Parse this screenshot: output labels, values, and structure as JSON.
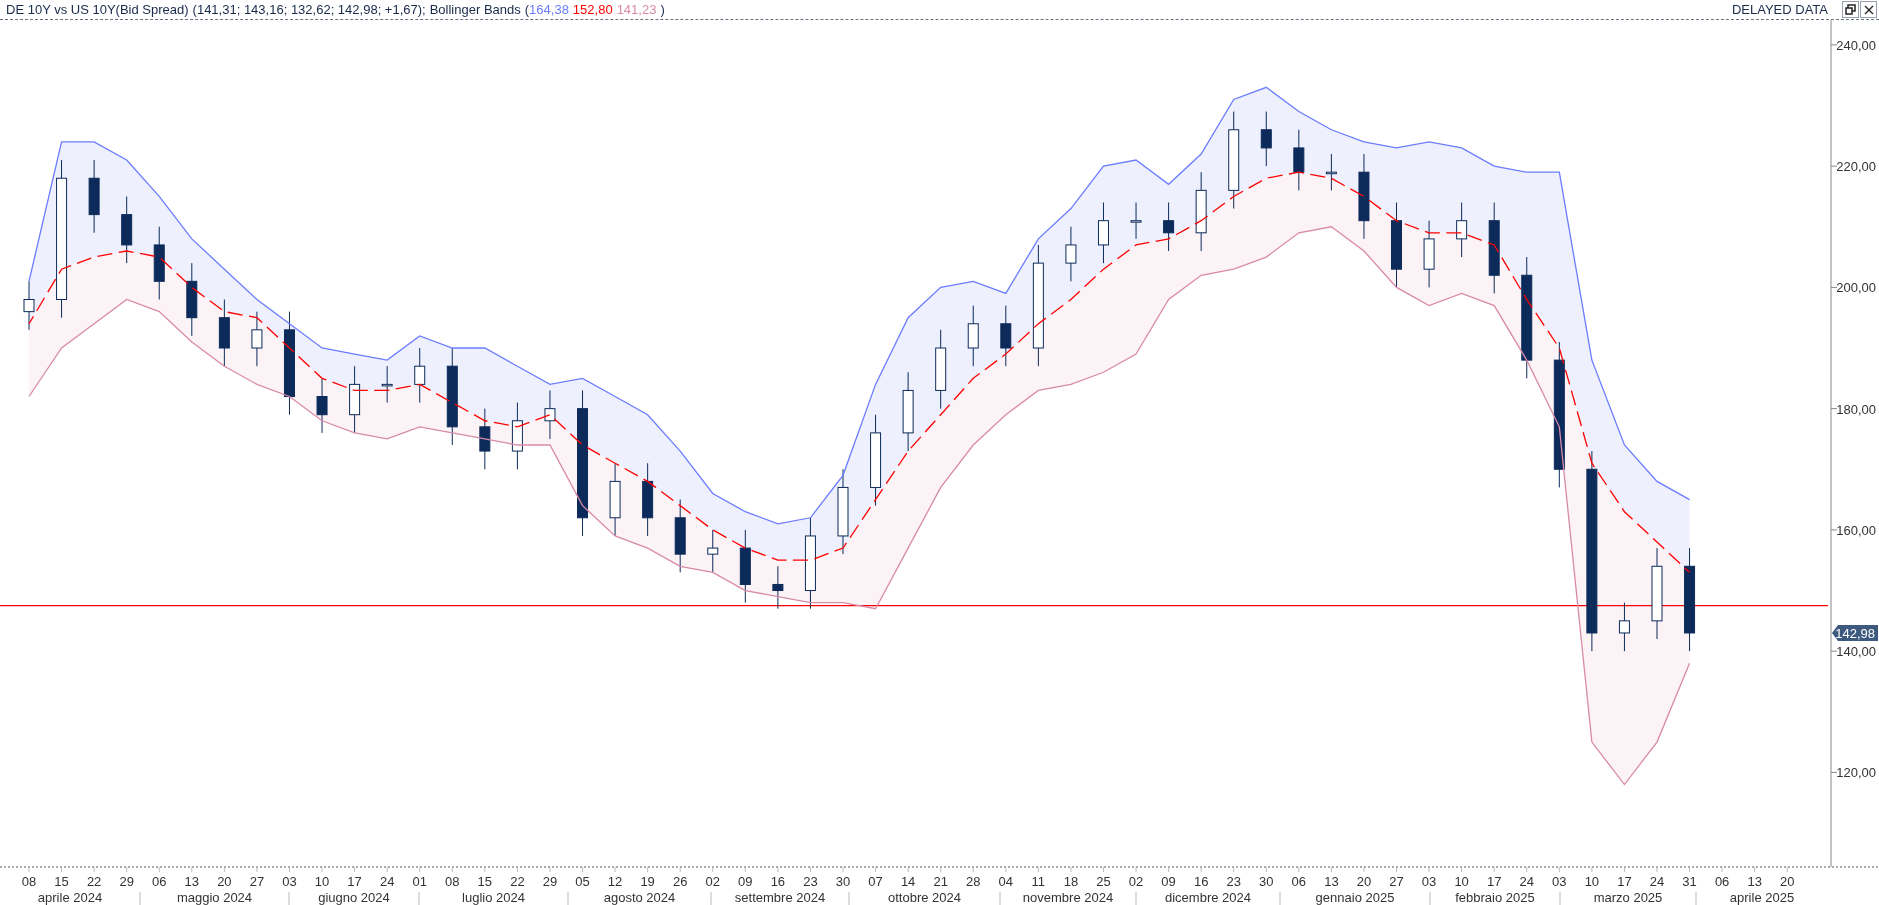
{
  "header": {
    "title": "DE 10Y vs US 10Y(Bid Spread)",
    "values": "(141,31; 143,16; 132,62; 142,98; +1,67);",
    "indicator": "Bollinger Bands",
    "open_paren": "(",
    "indicator_values": [
      {
        "text": "164,38",
        "color": "#6b7cff"
      },
      {
        "text": "152,80",
        "color": "#ff0000"
      },
      {
        "text": "141,23",
        "color": "#d98aa8"
      }
    ],
    "close_paren": ")",
    "status": "DELAYED DATA"
  },
  "chart": {
    "last_price": "142,98",
    "months": [
      "aprile 2024",
      "maggio 2024",
      "giugno 2024",
      "luglio 2024",
      "agosto 2024",
      "settembre 2024",
      "ottobre 2024",
      "novembre 2024",
      "dicembre 2024",
      "gennaio 2025",
      "febbraio 2025",
      "marzo 2025",
      "aprile 2025"
    ],
    "chart_data": {
      "type": "candlestick",
      "categories": [
        "08",
        "15",
        "22",
        "29",
        "06",
        "13",
        "20",
        "27",
        "03",
        "10",
        "17",
        "24",
        "01",
        "08",
        "15",
        "22",
        "29",
        "05",
        "12",
        "19",
        "26",
        "02",
        "09",
        "16",
        "23",
        "30",
        "07",
        "14",
        "21",
        "28",
        "04",
        "11",
        "18",
        "25",
        "02",
        "09",
        "16",
        "23",
        "30",
        "06",
        "13",
        "20",
        "27",
        "03",
        "10",
        "17",
        "24",
        "03",
        "10",
        "17",
        "24",
        "31",
        "06",
        "13",
        "20"
      ],
      "ylim": [
        104.4,
        244.1
      ],
      "yticks": [
        {
          "value": 120,
          "label": "120,00"
        },
        {
          "value": 140,
          "label": "140,00"
        },
        {
          "value": 160,
          "label": "160,00"
        },
        {
          "value": 180,
          "label": "180,00"
        },
        {
          "value": 200,
          "label": "200,00"
        },
        {
          "value": 220,
          "label": "220,00"
        },
        {
          "value": 240,
          "label": "240,00"
        }
      ],
      "ohlc": [
        [
          196,
          201,
          193,
          198
        ],
        [
          198,
          221,
          195,
          218
        ],
        [
          218,
          221,
          209,
          212
        ],
        [
          212,
          215,
          204,
          207
        ],
        [
          207,
          210,
          198,
          201
        ],
        [
          201,
          204,
          192,
          195
        ],
        [
          195,
          198,
          187,
          190
        ],
        [
          190,
          196,
          187,
          193
        ],
        [
          193,
          196,
          179,
          182
        ],
        [
          182,
          185,
          176,
          179
        ],
        [
          179,
          187,
          176,
          184
        ],
        [
          184,
          187,
          181,
          184
        ],
        [
          184,
          190,
          181,
          187
        ],
        [
          187,
          190,
          174,
          177
        ],
        [
          177,
          180,
          170,
          173
        ],
        [
          173,
          181,
          170,
          178
        ],
        [
          178,
          183,
          175,
          180
        ],
        [
          180,
          183,
          159,
          162
        ],
        [
          162,
          171,
          159,
          168
        ],
        [
          168,
          171,
          159,
          162
        ],
        [
          162,
          165,
          153,
          156
        ],
        [
          156,
          160,
          153,
          157
        ],
        [
          157,
          160,
          148,
          151
        ],
        [
          151,
          154,
          147,
          150
        ],
        [
          150,
          162,
          147,
          159
        ],
        [
          159,
          170,
          156,
          167
        ],
        [
          167,
          179,
          164,
          176
        ],
        [
          176,
          186,
          173,
          183
        ],
        [
          183,
          193,
          180,
          190
        ],
        [
          190,
          197,
          187,
          194
        ],
        [
          194,
          197,
          187,
          190
        ],
        [
          190,
          207,
          187,
          204
        ],
        [
          204,
          210,
          201,
          207
        ],
        [
          207,
          214,
          204,
          211
        ],
        [
          211,
          214,
          208,
          211
        ],
        [
          211,
          214,
          206,
          209
        ],
        [
          209,
          219,
          206,
          216
        ],
        [
          216,
          229,
          213,
          226
        ],
        [
          226,
          229,
          220,
          223
        ],
        [
          223,
          226,
          216,
          219
        ],
        [
          219,
          222,
          216,
          219
        ],
        [
          219,
          222,
          208,
          211
        ],
        [
          211,
          214,
          200,
          203
        ],
        [
          203,
          211,
          200,
          208
        ],
        [
          208,
          214,
          205,
          211
        ],
        [
          211,
          214,
          199,
          202
        ],
        [
          202,
          205,
          185,
          188
        ],
        [
          188,
          191,
          167,
          170
        ],
        [
          170,
          173,
          140,
          143
        ],
        [
          143,
          148,
          140,
          145
        ],
        [
          145,
          157,
          142,
          154
        ],
        [
          154,
          157,
          140,
          143
        ],
        null,
        null,
        null
      ],
      "series": [
        {
          "type": "line",
          "color": "#6b7cff",
          "values": [
            201,
            224,
            224,
            221,
            215,
            208,
            203,
            198,
            194,
            190,
            189,
            188,
            192,
            190,
            190,
            187,
            184,
            185,
            182,
            179,
            173,
            166,
            163,
            161,
            162,
            169,
            184,
            195,
            200,
            201,
            199,
            208,
            213,
            220,
            221,
            217,
            222,
            231,
            233,
            229,
            226,
            224,
            223,
            224,
            223,
            220,
            219,
            219,
            188,
            174,
            168,
            165,
            null,
            null,
            null
          ]
        },
        {
          "type": "line",
          "color": "#ff0000",
          "line_style": "dashed",
          "values": [
            194,
            203,
            205,
            206,
            205,
            200,
            196,
            195,
            190,
            185,
            183,
            183,
            184,
            181,
            178,
            177,
            179,
            174,
            171,
            168,
            164,
            160,
            157,
            155,
            155,
            157,
            165,
            173,
            179,
            185,
            189,
            194,
            198,
            203,
            207,
            208,
            211,
            215,
            218,
            219,
            218,
            215,
            211,
            209,
            209,
            207,
            198,
            190,
            171,
            163,
            158,
            153,
            null,
            null,
            null
          ]
        },
        {
          "type": "line",
          "color": "#d98aa8",
          "values": [
            182,
            190,
            194,
            198,
            196,
            191,
            187,
            184,
            182,
            178,
            176,
            175,
            177,
            176,
            175,
            174,
            174,
            164,
            159,
            157,
            154,
            153,
            150,
            149,
            148,
            148,
            147,
            157,
            167,
            174,
            179,
            183,
            184,
            186,
            189,
            198,
            202,
            203,
            205,
            209,
            210,
            206,
            200,
            197,
            199,
            197,
            188,
            177,
            125,
            118,
            125,
            138,
            null,
            null,
            null
          ]
        }
      ],
      "ref_lines": [
        {
          "axis": "y",
          "value": 147.5,
          "color": "#ff0000"
        }
      ]
    }
  }
}
